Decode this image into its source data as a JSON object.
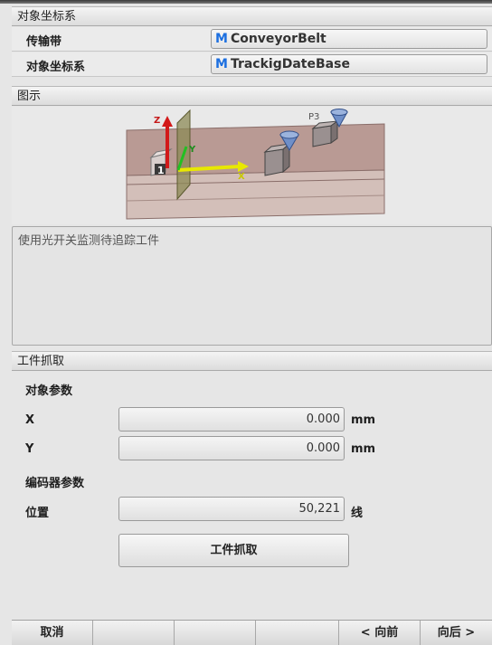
{
  "object_frame": {
    "title": "对象坐标系",
    "rows": [
      {
        "label": "传输带",
        "badge": "M",
        "value": "ConveyorBelt"
      },
      {
        "label": "对象坐标系",
        "badge": "M",
        "value": "TrackigDateBase"
      }
    ]
  },
  "illustration": {
    "title": "图示",
    "labels": {
      "z": "Z",
      "y": "Y",
      "x": "X",
      "p3": "P3",
      "marker": "1"
    },
    "description": "使用光开关监测待追踪工件"
  },
  "pickup": {
    "title": "工件抓取",
    "object_params_label": "对象参数",
    "x_label": "X",
    "x_value": "0.000",
    "y_label": "Y",
    "y_value": "0.000",
    "unit_mm": "mm",
    "encoder_params_label": "编码器参数",
    "position_label": "位置",
    "position_value": "50,221",
    "unit_lines": "线",
    "button_label": "工件抓取"
  },
  "footer": {
    "cancel": "取消",
    "prev": "< 向前",
    "next": "向后 >"
  }
}
